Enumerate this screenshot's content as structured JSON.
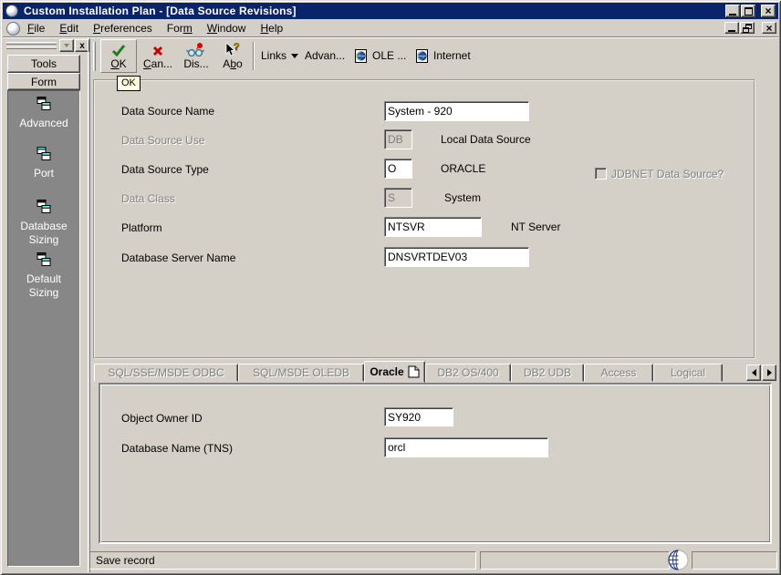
{
  "window": {
    "title": "Custom Installation Plan - [Data Source Revisions]",
    "statusbar_message": "Save record"
  },
  "colors": {
    "titlebar": "#0a246a",
    "window_bg": "#d4d0c8",
    "sidebar_panel": "#878787",
    "ok_check": "#008000",
    "cancel_x": "#cc0000",
    "disabled_text": "#808080"
  },
  "menu": {
    "items": [
      {
        "pre": "",
        "u": "F",
        "post": "ile"
      },
      {
        "pre": "",
        "u": "E",
        "post": "dit"
      },
      {
        "pre": "",
        "u": "P",
        "post": "references"
      },
      {
        "pre": "For",
        "u": "m",
        "post": ""
      },
      {
        "pre": "",
        "u": "W",
        "post": "indow"
      },
      {
        "pre": "",
        "u": "H",
        "post": "elp"
      }
    ]
  },
  "toolbar": {
    "buttons": [
      {
        "pre": "",
        "u": "O",
        "post": "K",
        "icon": "check-icon"
      },
      {
        "pre": "",
        "u": "C",
        "post": "an...",
        "icon": "cancel-x-icon"
      },
      {
        "pre": "Dis...",
        "u": "",
        "post": "",
        "icon": "glasses-icon"
      },
      {
        "pre": "A",
        "u": "b",
        "post": "o",
        "icon": "help-cursor-icon"
      }
    ],
    "links_label": "Links",
    "advanced_label": "Advan...",
    "ole_label": "OLE ...",
    "internet_label": "Internet",
    "tooltip": "OK"
  },
  "sidebar": {
    "tools_tab": "Tools",
    "form_tab": "Form",
    "items": [
      {
        "label": "Advanced"
      },
      {
        "label": "Port"
      },
      {
        "label": "Database Sizing"
      },
      {
        "label": "Default Sizing"
      }
    ]
  },
  "form": {
    "fields": [
      {
        "label": "Data Source Name",
        "value": "System - 920",
        "desc": "",
        "disabled": false
      },
      {
        "label": "Data Source Use",
        "value": "DB",
        "desc": "Local Data Source",
        "disabled": true
      },
      {
        "label": "Data Source Type",
        "value": "O",
        "desc": "ORACLE",
        "disabled": false
      },
      {
        "label": "Data Class",
        "value": "S",
        "desc": "System",
        "disabled": true
      },
      {
        "label": "Platform",
        "value": "NTSVR",
        "desc": "NT Server",
        "disabled": false
      },
      {
        "label": "Database Server Name",
        "value": "DNSVRTDEV03",
        "desc": "",
        "disabled": false
      }
    ],
    "checkbox_label": "JDBNET Data Source?",
    "checkbox_checked": false
  },
  "tabs": {
    "items": [
      "SQL/SSE/MSDE ODBC",
      "SQL/MSDE OLEDB",
      "Oracle",
      "DB2 OS/400",
      "DB2 UDB",
      "Access",
      "Logical"
    ],
    "active": "Oracle"
  },
  "oracle_tab": {
    "fields": [
      {
        "label": "Object Owner ID",
        "value": "SY920"
      },
      {
        "label": "Database Name (TNS)",
        "value": "orcl"
      }
    ]
  }
}
